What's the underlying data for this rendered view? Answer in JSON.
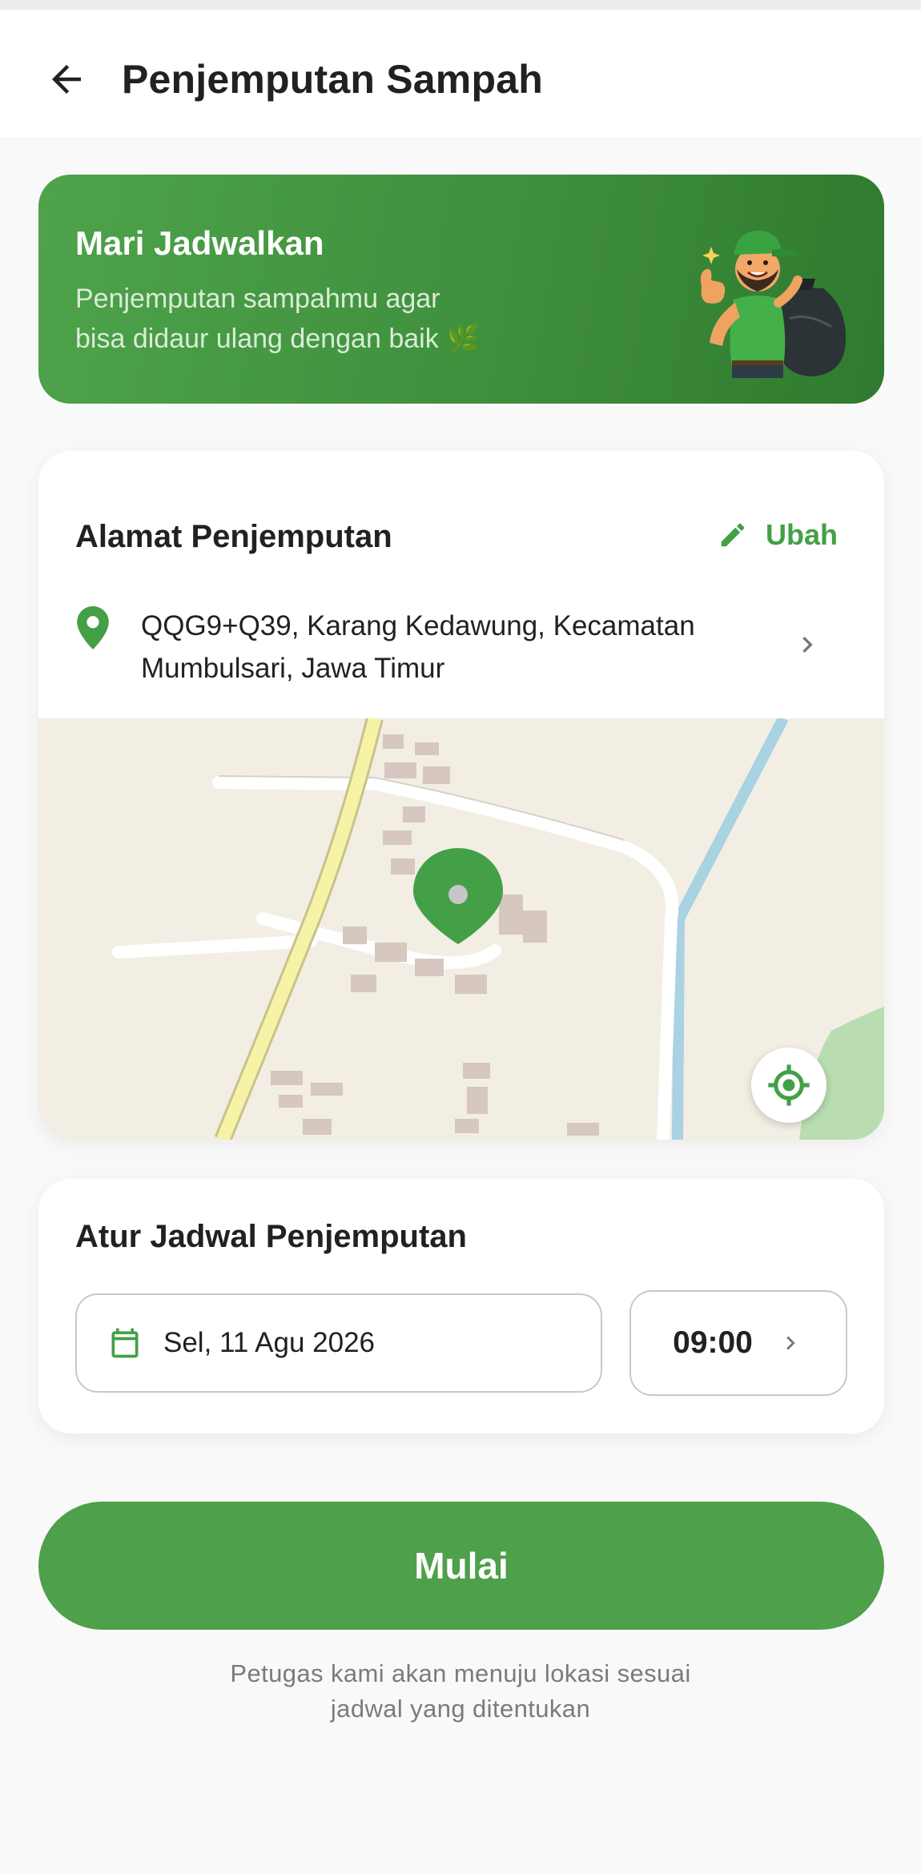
{
  "header": {
    "title": "Penjemputan Sampah",
    "back_icon": "arrow-left-icon"
  },
  "banner": {
    "title": "Mari Jadwalkan",
    "subtitle_line1": "Penjemputan sampahmu agar",
    "subtitle_line2": "bisa didaur ulang dengan baik 🌿",
    "illustration": "garbage-collector-thumbs-up-illustration",
    "colors": {
      "start": "#4ea34a",
      "end": "#2f7a2f"
    }
  },
  "address": {
    "title": "Alamat Penjemputan",
    "edit_label": "Ubah",
    "edit_icon": "pencil-icon",
    "pin_icon": "location-pin-icon",
    "line1": "QQG9+Q39, Karang Kedawung, Kecamatan",
    "line2": "Mumbulsari, Jawa Timur",
    "chevron_icon": "chevron-right-icon",
    "map_locate_icon": "my-location-icon"
  },
  "schedule": {
    "title": "Atur Jadwal Penjemputan",
    "date_icon": "calendar-icon",
    "date_value": "Sel, 11 Agu 2026",
    "time_value": "09:00",
    "time_chevron_icon": "chevron-right-icon"
  },
  "action": {
    "start_label": "Mulai"
  },
  "footer": {
    "note_line1": "Petugas kami akan menuju lokasi sesuai",
    "note_line2": "jadwal yang ditentukan"
  },
  "colors": {
    "primary": "#43a047",
    "button": "#4ea04a",
    "text": "#212121",
    "muted": "#7b7b7b"
  }
}
